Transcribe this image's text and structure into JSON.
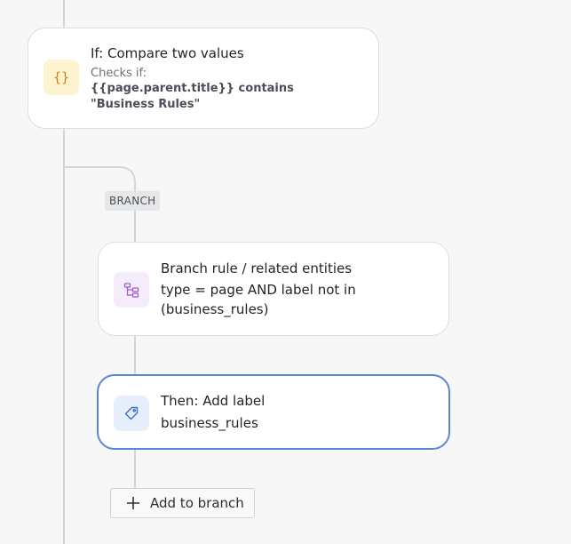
{
  "condition_card": {
    "icon": "curly-braces-icon",
    "title": "If: Compare two values",
    "checks_label": "Checks if:",
    "checks_expression": "{{page.parent.title}} contains \"Business Rules\""
  },
  "branch": {
    "badge": "BRANCH"
  },
  "branch_rule_card": {
    "icon": "hierarchy-icon",
    "title": "Branch rule / related entities",
    "detail": "type = page AND label not in (business_rules)"
  },
  "action_card": {
    "icon": "tag-icon",
    "title": "Then: Add label",
    "detail": "business_rules"
  },
  "add_to_branch": {
    "label": "Add to branch"
  },
  "colors": {
    "condition_icon_bg": "#fff4d0",
    "condition_icon_fg": "#d97a1e",
    "branch_icon_bg": "#f4ecfb",
    "branch_icon_fg": "#a05ad0",
    "action_icon_bg": "#e7eefb",
    "action_icon_fg": "#3d6fd1",
    "selected_border": "#5b86d6"
  }
}
